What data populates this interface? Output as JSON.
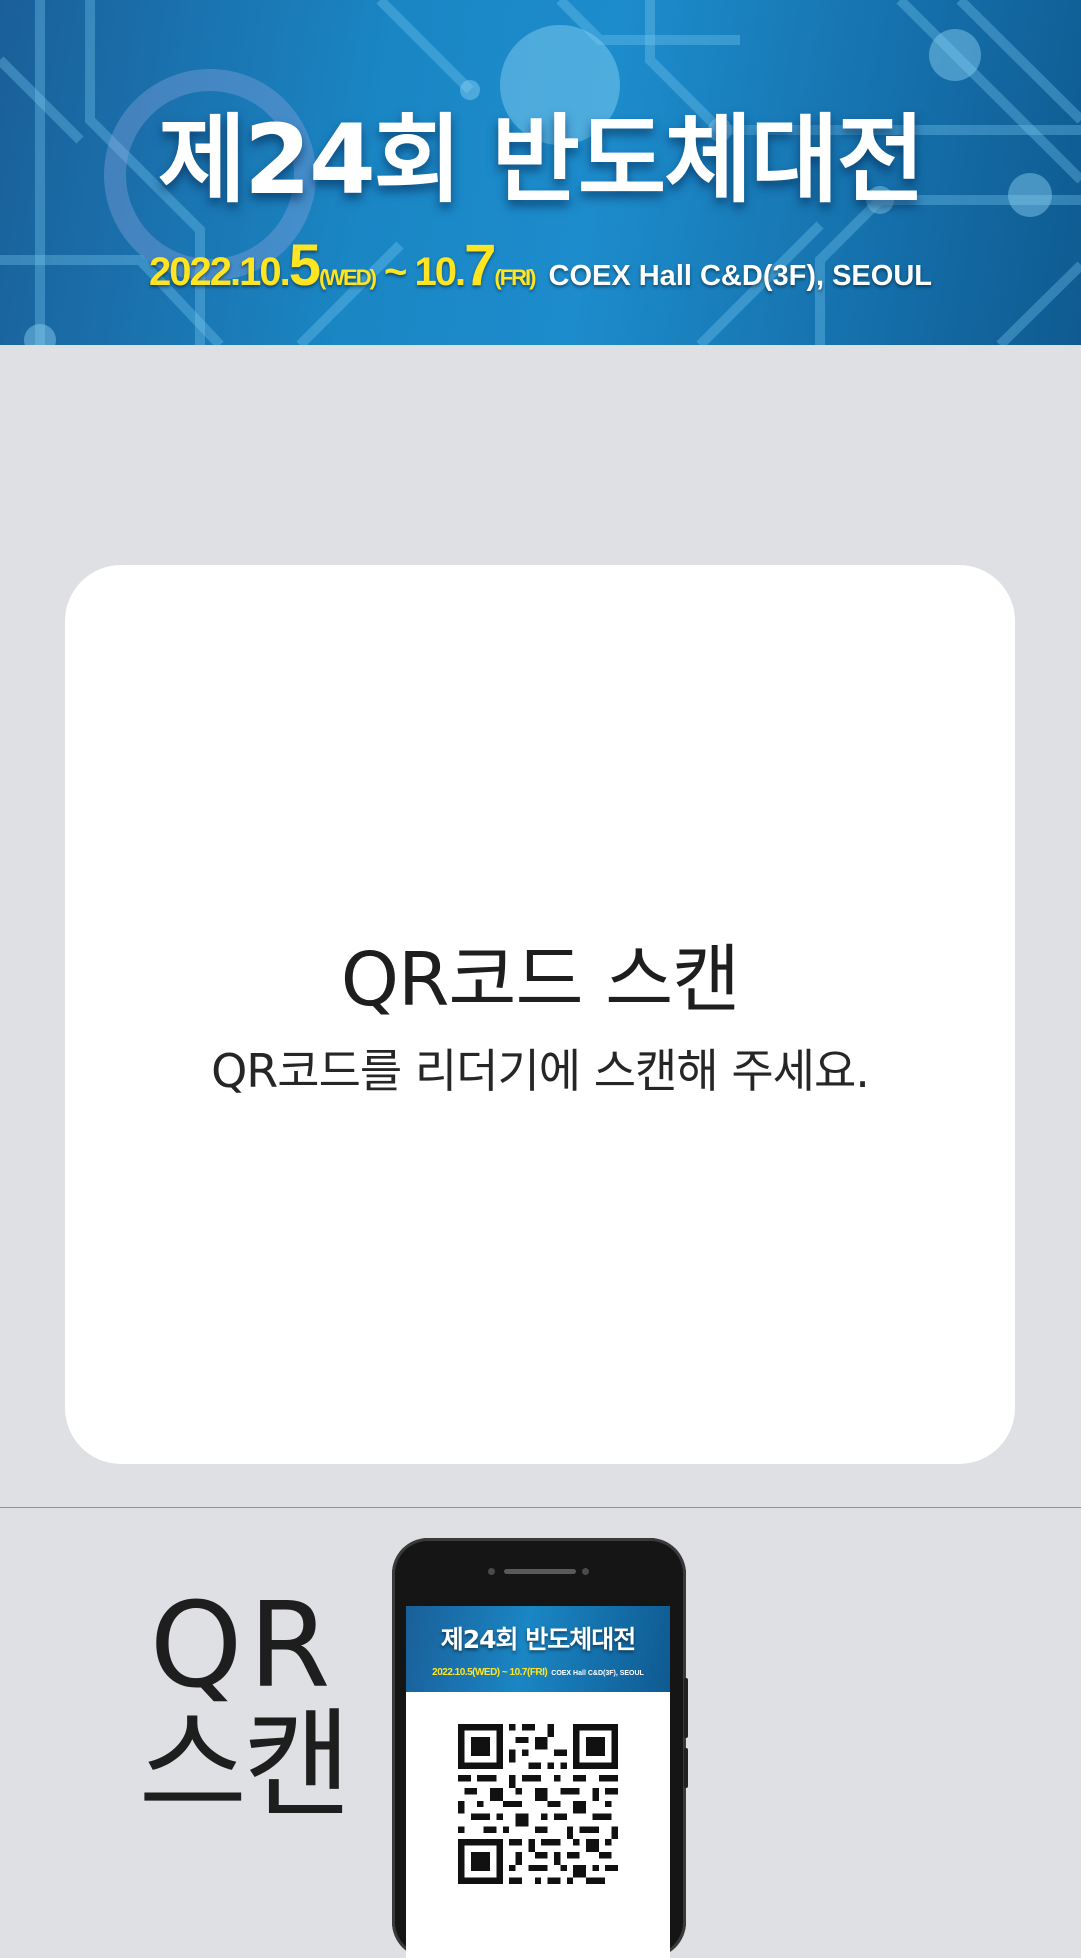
{
  "banner": {
    "title": "제24회 반도체대전",
    "date_start": "2022.10.",
    "date_start_day": "5",
    "date_start_weekday": "(WED)",
    "date_separator": " ~ ",
    "date_end": "10.",
    "date_end_day": "7",
    "date_end_weekday": "(FRI)",
    "venue": "COEX Hall C&D(3F), SEOUL"
  },
  "card": {
    "title": "QR코드 스캔",
    "description": "QR코드를 리더기에 스캔해 주세요."
  },
  "bottom": {
    "label_line1": "QR",
    "label_line2": "스캔",
    "phone_banner_title": "제24회 반도체대전",
    "phone_banner_date": "2022.10.5(WED) ~ 10.7(FRI)",
    "phone_banner_venue": "COEX Hall C&D(3F), SEOUL"
  },
  "colors": {
    "background": "#dfe0e4",
    "banner_blue": "#1a86c4",
    "date_yellow": "#ffe521",
    "card": "#ffffff",
    "text": "#1e1e1e"
  },
  "icons": {
    "phone": "smartphone-illustration",
    "qr": "qr-code-graphic"
  }
}
